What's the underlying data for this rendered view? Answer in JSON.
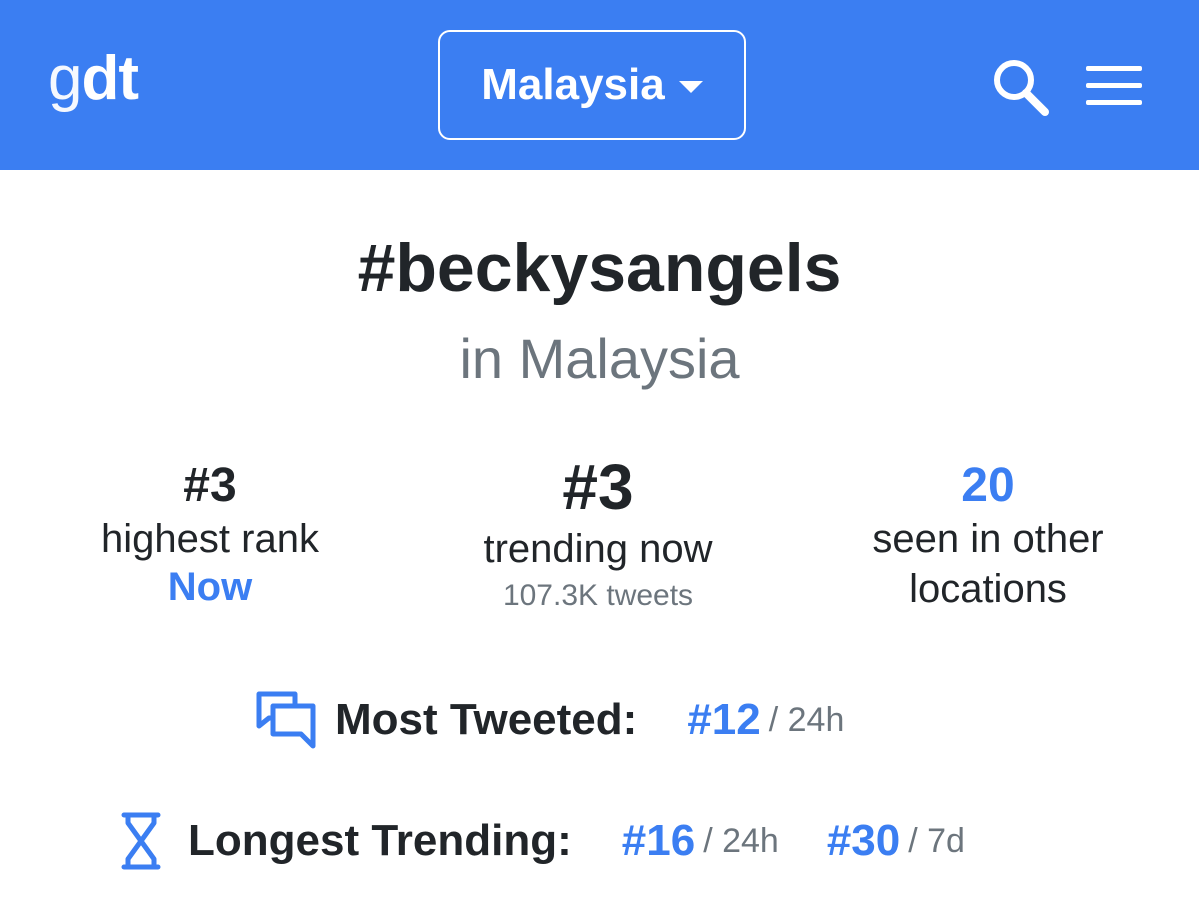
{
  "header": {
    "logo_g": "g",
    "logo_dt": "dt",
    "country": "Malaysia",
    "icons": {
      "search": "search-icon",
      "menu": "hamburger-menu-icon",
      "dropdown": "caret-down-icon"
    },
    "accent_color": "#3b7ef2"
  },
  "trend": {
    "hashtag": "#beckysangels",
    "location": "in Malaysia"
  },
  "stats": {
    "highest_rank": {
      "value": "#3",
      "label": "highest rank",
      "when": "Now"
    },
    "trending_now": {
      "value": "#3",
      "label": "trending now",
      "tweets": "107.3K tweets"
    },
    "other_locations": {
      "value": "20",
      "label_line1": "seen in other",
      "label_line2": "locations"
    }
  },
  "most_tweeted": {
    "title": "Most Tweeted:",
    "icon": "chat-bubbles-icon",
    "rank": "#12",
    "period": "/ 24h"
  },
  "longest_trending": {
    "title": "Longest Trending:",
    "icon": "hourglass-icon",
    "entries": [
      {
        "rank": "#16",
        "period": "/ 24h"
      },
      {
        "rank": "#30",
        "period": "/ 7d"
      }
    ]
  }
}
